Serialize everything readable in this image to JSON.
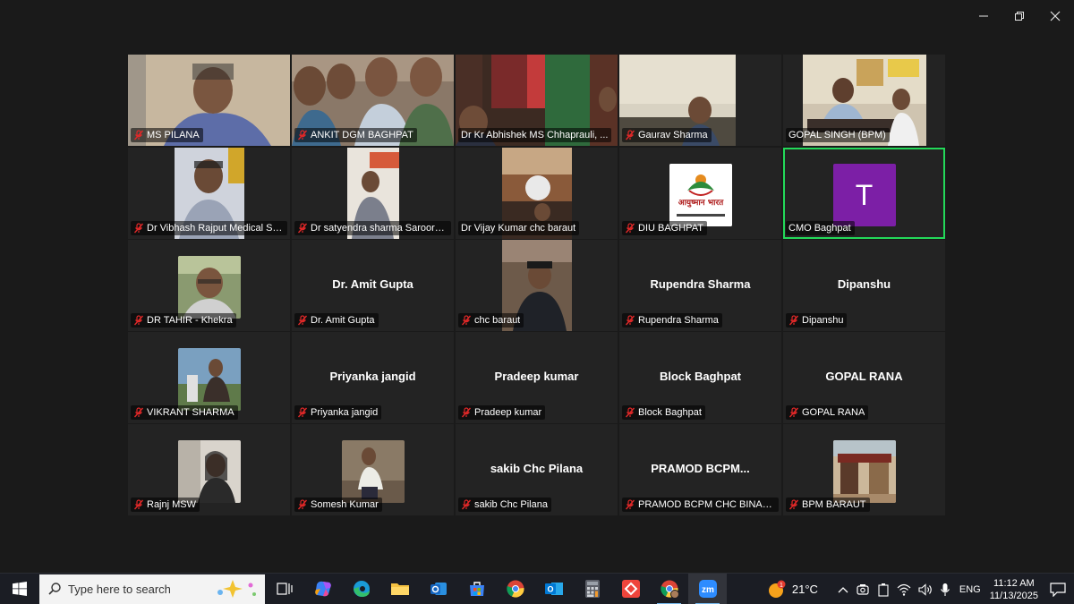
{
  "window": {
    "minimize_label": "—",
    "restore_label": "❐",
    "close_label": "✕"
  },
  "participants": [
    {
      "name": "MS PILANA",
      "tile_label": "",
      "type": "video"
    },
    {
      "name": "ANKIT DGM BAGHPAT",
      "tile_label": "",
      "type": "video"
    },
    {
      "name": "Dr Kr Abhishek MS Chhaprauli, ...",
      "tile_label": "",
      "type": "video"
    },
    {
      "name": "Gaurav Sharma",
      "tile_label": "",
      "type": "video"
    },
    {
      "name": "GOPAL SINGH (BPM)",
      "tile_label": "",
      "type": "video"
    },
    {
      "name": "Dr Vibhash Rajput Medical Supe...",
      "tile_label": "",
      "type": "photo"
    },
    {
      "name": "Dr satyendra sharma Saroorp...",
      "tile_label": "",
      "type": "photo"
    },
    {
      "name": "Dr Vijay Kumar chc baraut",
      "tile_label": "",
      "type": "video"
    },
    {
      "name": "DIU BAGHPAT",
      "tile_label": "आयुष्मान भारत",
      "type": "logo"
    },
    {
      "name": "CMO Baghpat",
      "tile_label": "T",
      "type": "letter",
      "active": true
    },
    {
      "name": "DR TAHIR - Khekra",
      "tile_label": "",
      "type": "photo"
    },
    {
      "name": "Dr. Amit  Gupta",
      "tile_label": "Dr. Amit  Gupta",
      "type": "text"
    },
    {
      "name": "chc baraut",
      "tile_label": "",
      "type": "video"
    },
    {
      "name": "Rupendra Sharma",
      "tile_label": "Rupendra Sharma",
      "type": "text"
    },
    {
      "name": "Dipanshu",
      "tile_label": "Dipanshu",
      "type": "text"
    },
    {
      "name": "VIKRANT SHARMA",
      "tile_label": "",
      "type": "photo"
    },
    {
      "name": "Priyanka jangid",
      "tile_label": "Priyanka jangid",
      "type": "text"
    },
    {
      "name": "Pradeep kumar",
      "tile_label": "Pradeep kumar",
      "type": "text"
    },
    {
      "name": "Block Baghpat",
      "tile_label": "Block Baghpat",
      "type": "text"
    },
    {
      "name": "GOPAL RANA",
      "tile_label": "GOPAL RANA",
      "type": "text"
    },
    {
      "name": "Rajnj MSW",
      "tile_label": "",
      "type": "photo"
    },
    {
      "name": "Somesh Kumar",
      "tile_label": "",
      "type": "photo"
    },
    {
      "name": "sakib Chc Pilana",
      "tile_label": "sakib Chc Pilana",
      "type": "text"
    },
    {
      "name": "PRAMOD BCPM CHC BINAULI",
      "tile_label": "PRAMOD  BCPM...",
      "type": "text"
    },
    {
      "name": "BPM BARAUT",
      "tile_label": "",
      "type": "photo"
    }
  ],
  "taskbar": {
    "search_placeholder": "Type here to search",
    "weather_temp": "21°C",
    "language": "ENG",
    "time": "11:12 AM",
    "date": "11/13/2025",
    "weather_badge": "1"
  },
  "colors": {
    "active_speaker_border": "#23d959",
    "cmo_avatar": "#7c1fa6",
    "background": "#1a1a1a",
    "taskbar": "#1b1d24"
  }
}
